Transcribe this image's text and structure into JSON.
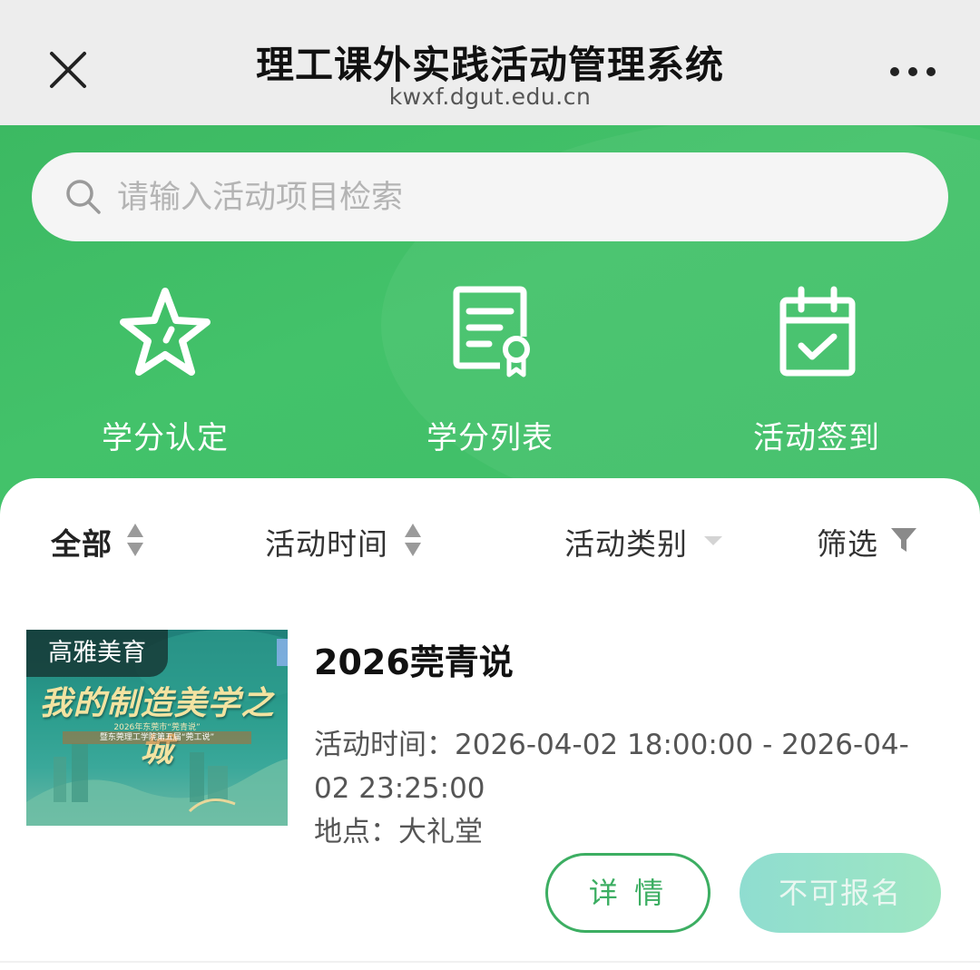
{
  "topbar": {
    "title": "理工课外实践活动管理系统",
    "url": "kwxf.dgut.edu.cn",
    "close_icon": "close-icon",
    "more_icon": "more-dots-icon"
  },
  "search": {
    "placeholder": "请输入活动项目检索",
    "icon": "search-icon"
  },
  "nav": {
    "items": [
      {
        "label": "学分认定",
        "icon": "star-icon"
      },
      {
        "label": "学分列表",
        "icon": "certificate-icon"
      },
      {
        "label": "活动签到",
        "icon": "calendar-check-icon"
      }
    ]
  },
  "filters": {
    "items": [
      {
        "label": "全部",
        "icon": "sort-icon"
      },
      {
        "label": "活动时间",
        "icon": "sort-icon"
      },
      {
        "label": "活动类别",
        "icon": "dropdown-icon"
      },
      {
        "label": "筛选",
        "icon": "funnel-icon"
      }
    ]
  },
  "activity": {
    "tag": "高雅美育",
    "image_slogan": "我的制造美学之城",
    "image_sub1": "2026年东莞市“莞青说”",
    "image_sub2": "暨东莞理工学院第五届“莞工说”",
    "title": "2026莞青说",
    "time_label": "活动时间：",
    "time_value": "2026-04-02 18:00:00 - 2026-04-02 23:25:00",
    "place_label": "地点：",
    "place_value": "大礼堂",
    "detail_button": "详 情",
    "signup_button": "不可报名"
  },
  "colors": {
    "brand_green": "#3cb962",
    "detail_border": "#3cae62",
    "signup_disabled": "#9ee6c2"
  }
}
